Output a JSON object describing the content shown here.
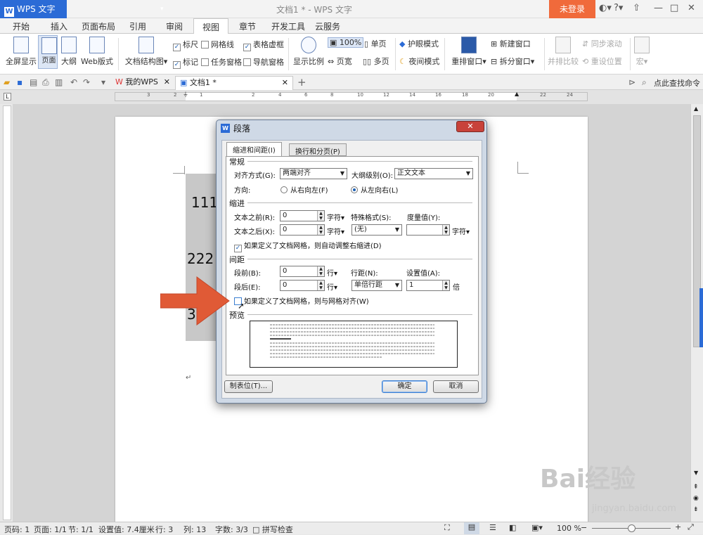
{
  "titlebar": {
    "app_name": "WPS 文字",
    "doc_title": "文档1 * - WPS 文字",
    "login": "未登录"
  },
  "menu_tabs": [
    "开始",
    "插入",
    "页面布局",
    "引用",
    "审阅",
    "视图",
    "章节",
    "开发工具",
    "云服务"
  ],
  "ribbon": {
    "full_screen": "全屏显示",
    "page_view": "页面",
    "outline": "大纲",
    "web": "Web版式",
    "doc_map": "文档结构图",
    "ruler": "标尺",
    "gridlines": "网格线",
    "table_frame": "表格虚框",
    "mark": "标记",
    "task_pane": "任务窗格",
    "nav_pane": "导航窗格",
    "zoom": "显示比例",
    "zoom_100": "100%",
    "single_page": "单页",
    "page_width": "页宽",
    "multi_page": "多页",
    "eye_mode": "护眼模式",
    "night_mode": "夜间模式",
    "rearrange": "重排窗口",
    "new_window": "新建窗口",
    "split_window": "拆分窗口",
    "side_by_side": "并排比较",
    "sync_scroll": "同步滚动",
    "reset_pos": "重设位置",
    "macro": "宏"
  },
  "tabs_bar": {
    "my_wps": "我的WPS",
    "doc1": "文档1 *",
    "search_cmd": "点此查找命令"
  },
  "ruler_numbers": [
    "3",
    "2",
    "1",
    "",
    "2",
    "4",
    "6",
    "8",
    "10",
    "12",
    "14",
    "16",
    "18",
    "20",
    "",
    "22",
    "24"
  ],
  "document": {
    "line1": "111",
    "line2": "222",
    "line3": "33"
  },
  "dialog": {
    "title": "段落",
    "tab_indent": "缩进和间距(I)",
    "tab_break": "换行和分页(P)",
    "sec_general": "常规",
    "align_label": "对齐方式(G):",
    "align_value": "两端对齐",
    "outline_label": "大纲级别(O):",
    "outline_value": "正文文本",
    "direction_label": "方向:",
    "rtl": "从右向左(F)",
    "ltr": "从左向右(L)",
    "sec_indent": "缩进",
    "before_text": "文本之前(R):",
    "before_value": "0",
    "unit_char": "字符",
    "special_label": "特殊格式(S):",
    "special_value": "(无)",
    "measure_label": "度量值(Y):",
    "after_text": "文本之后(X):",
    "after_value": "0",
    "auto_right": "如果定义了文档网格，则自动调整右缩进(D)",
    "sec_spacing": "间距",
    "before_para": "段前(B):",
    "before_para_value": "0",
    "unit_line": "行",
    "line_spacing_label": "行距(N):",
    "line_spacing_value": "单倍行距",
    "set_value_label": "设置值(A):",
    "set_value": "1",
    "unit_times": "倍",
    "after_para": "段后(E):",
    "after_para_value": "0",
    "snap_grid": "如果定义了文档网格，则与网格对齐(W)",
    "preview": "预览",
    "tab_stops": "制表位(T)...",
    "ok": "确定",
    "cancel": "取消"
  },
  "status": {
    "page_no": "页码: 1",
    "pages": "页面: 1/1",
    "section": "节: 1/1",
    "setting": "设置值: 7.4厘米",
    "row": "行: 3",
    "col": "列: 13",
    "words": "字数: 3/3",
    "spell": "拼写检查",
    "zoom": "100 %"
  },
  "watermark": {
    "brand": "Bai经验",
    "url": "jingyan.baidu.com"
  },
  "colors": {
    "accent": "#2b6bd6",
    "login": "#f06a3b",
    "arrow": "#e05a36"
  }
}
